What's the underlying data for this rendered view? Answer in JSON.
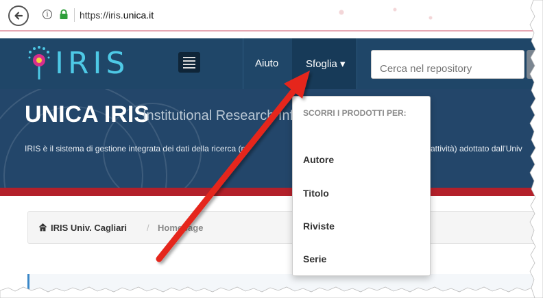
{
  "browser": {
    "url_prefix": "https://iris.",
    "url_domain": "unica.it",
    "back_icon": "back-arrow-icon",
    "info_icon": "info-icon",
    "lock_icon": "lock-icon"
  },
  "navbar": {
    "logo_text": "IRIS",
    "menu_icon": "hamburger-icon",
    "items": [
      {
        "label": "Aiuto"
      },
      {
        "label": "Sfoglia ▾"
      }
    ],
    "search_placeholder": "Cerca nel repository"
  },
  "banner": {
    "title": "UNICA IRIS",
    "subtitle": "Institutional Research Inf",
    "description_left": "IRIS è il sistema di gestione integrata dei dati della ricerca (p",
    "description_right": "attività) adottato dall'Univ"
  },
  "breadcrumb": {
    "home_label": "IRIS Univ. Cagliari",
    "separator": "/",
    "current_label": "Homepage"
  },
  "dropdown": {
    "header": "SCORRI I PRODOTTI PER:",
    "items": [
      {
        "label": "Autore"
      },
      {
        "label": "Titolo"
      },
      {
        "label": "Riviste"
      },
      {
        "label": "Serie"
      }
    ]
  },
  "colors": {
    "navbar": "#1f4668",
    "banner": "#23466a",
    "accent_red": "#b3202a",
    "arrow": "#e5261f",
    "logo": "#4ec9e6"
  }
}
